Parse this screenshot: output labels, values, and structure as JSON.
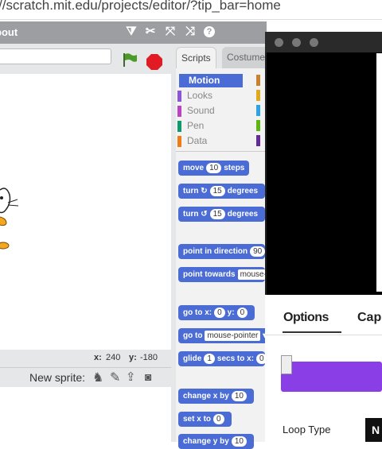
{
  "browser": {
    "url": "//scratch.mit.edu/projects/editor/?tip_bar=home"
  },
  "topbar": {
    "title": "bout"
  },
  "stage": {
    "coords": {
      "x_label": "x:",
      "x_value": "240",
      "y_label": "y:",
      "y_value": "-180"
    },
    "new_sprite_label": "New sprite:"
  },
  "tabs": {
    "scripts": "Scripts",
    "costumes": "Costume"
  },
  "categories": [
    {
      "label": "Motion",
      "color": "#4a6cd4"
    },
    {
      "label": "Looks",
      "color": "#8a55d7"
    },
    {
      "label": "Sound",
      "color": "#bb42c3"
    },
    {
      "label": "Pen",
      "color": "#0e9a6c"
    },
    {
      "label": "Data",
      "color": "#ee7d16"
    }
  ],
  "blocks": {
    "move": {
      "pre": "move",
      "num": "10",
      "post": "steps"
    },
    "turn_right": {
      "pre": "turn",
      "num": "15",
      "post": "degrees"
    },
    "turn_left": {
      "pre": "turn",
      "num": "15",
      "post": "degrees"
    },
    "point_dir": {
      "pre": "point in direction",
      "num": "90"
    },
    "point_towards": {
      "pre": "point towards",
      "drop": "mouse-"
    },
    "goto_xy": {
      "pre": "go to x:",
      "x": "0",
      "mid": "y:",
      "y": "0"
    },
    "goto": {
      "pre": "go to",
      "drop": "mouse-pointer"
    },
    "glide": {
      "pre": "glide",
      "num": "1",
      "post": "secs to x:",
      "x": "0"
    },
    "change_x": {
      "pre": "change x by",
      "num": "10"
    },
    "set_x": {
      "pre": "set x to",
      "num": "0"
    },
    "change_y": {
      "pre": "change y by",
      "num": "10"
    }
  },
  "overlay": {
    "options_tab": "Options",
    "capture_tab": "Cap",
    "loop_type_label": "Loop Type",
    "loop_button": "N"
  }
}
